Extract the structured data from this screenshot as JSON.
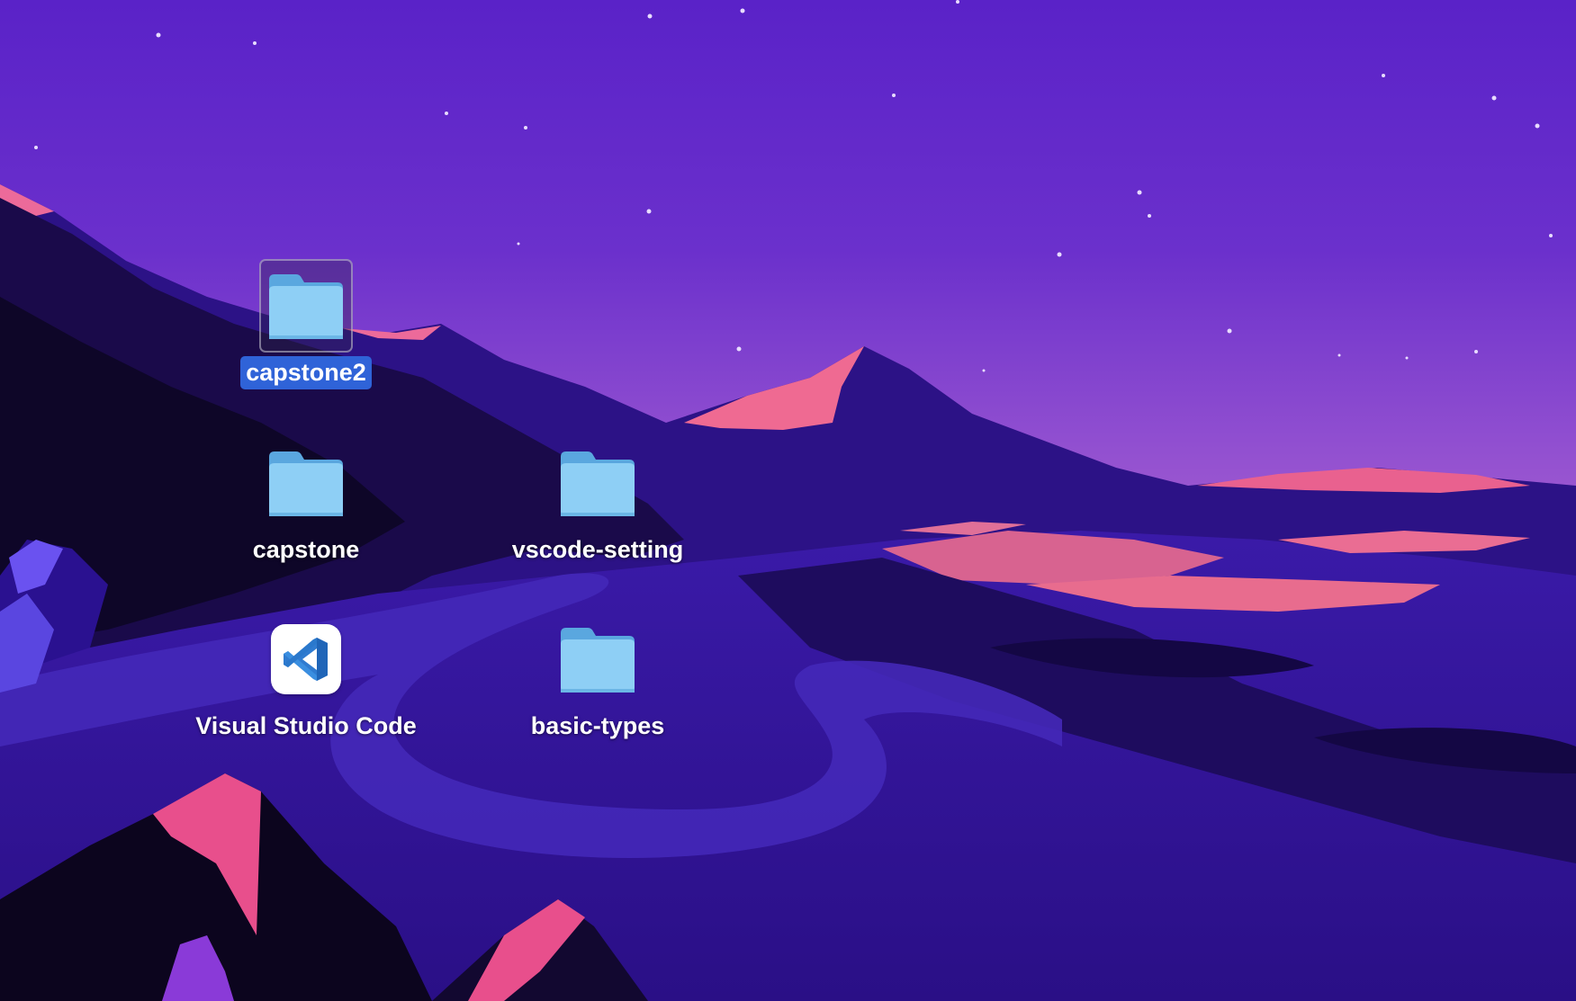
{
  "desktop": {
    "items": [
      {
        "label": "capstone2",
        "kind": "folder",
        "selected": true,
        "icon": "folder-icon"
      },
      {
        "label": "capstone",
        "kind": "folder",
        "selected": false,
        "icon": "folder-icon"
      },
      {
        "label": "vscode-setting",
        "kind": "folder",
        "selected": false,
        "icon": "folder-icon"
      },
      {
        "label": "Visual Studio Code",
        "kind": "application",
        "selected": false,
        "icon": "vscode-app-icon"
      },
      {
        "label": "basic-types",
        "kind": "folder",
        "selected": false,
        "icon": "folder-icon"
      }
    ]
  },
  "colors": {
    "selection_highlight": "#2f63d8",
    "folder_blue": "#8ecff5",
    "folder_tab": "#5aa7df",
    "vscode_blue": "#2f7bd0",
    "sky_top": "#5a22c8",
    "horizon_pink": "#ef6a92"
  }
}
